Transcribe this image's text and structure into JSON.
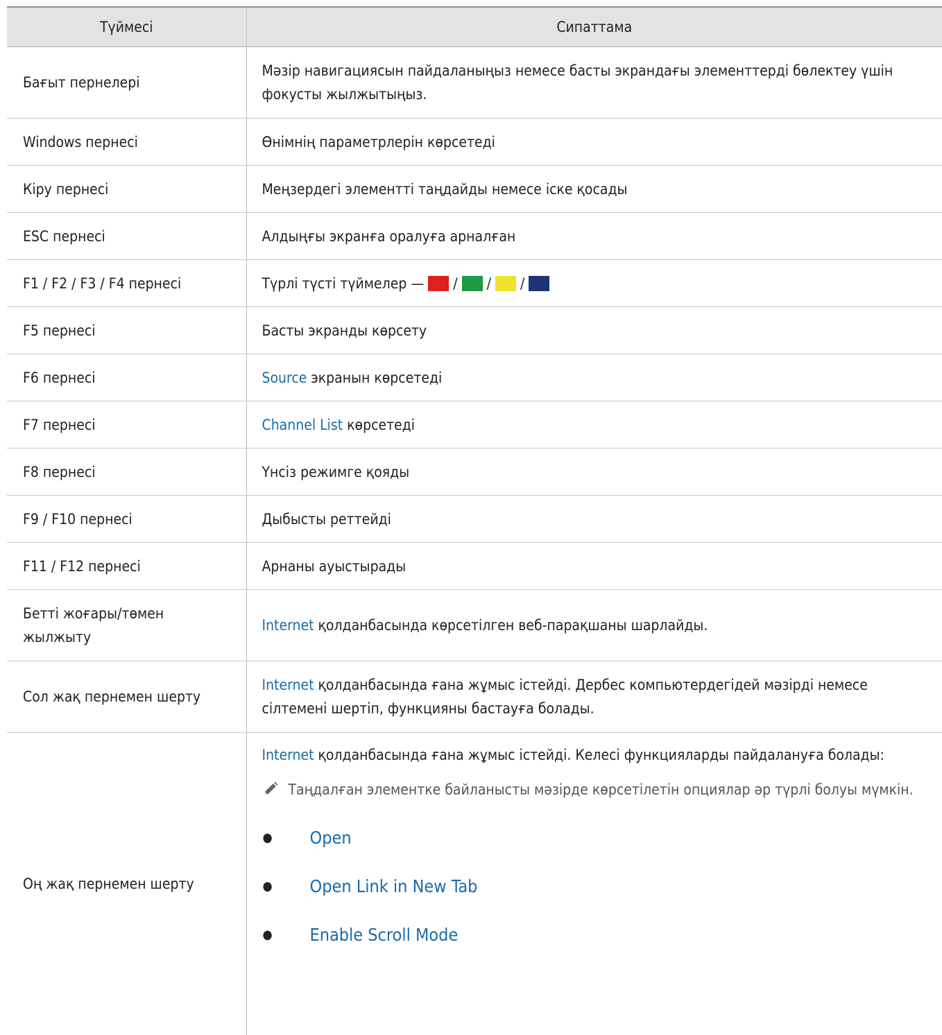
{
  "header": {
    "col_button": "Түймесі",
    "col_desc": "Сипаттама"
  },
  "rows": {
    "arrows": {
      "key": "Бағыт пернелері",
      "desc": "Мәзір навигациясын пайдаланыңыз немесе басты экрандағы элементтерді бөлектеу үшін фокусты жылжытыңыз."
    },
    "windows": {
      "key": "Windows пернесі",
      "desc": "Өнімнің параметрлерін көрсетеді"
    },
    "enter": {
      "key": "Кіру пернесі",
      "desc": "Меңзердегі элементті таңдайды немесе іске қосады"
    },
    "esc": {
      "key": "ESC пернесі",
      "desc": "Алдыңғы экранға оралуға арналған"
    },
    "f1f4": {
      "key": "F1 / F2 / F3 / F4 пернесі",
      "desc": "Түрлі түсті түймелер —",
      "sep": "/"
    },
    "f5": {
      "key": "F5 пернесі",
      "desc": "Басты экранды көрсету"
    },
    "f6": {
      "key": "F6 пернесі",
      "link": "Source",
      "desc": "экранын көрсетеді"
    },
    "f7": {
      "key": "F7 пернесі",
      "link": "Channel List",
      "desc": "көрсетеді"
    },
    "f8": {
      "key": "F8 пернесі",
      "desc": "Үнсіз режимге қояды"
    },
    "f9f10": {
      "key": "F9 / F10 пернесі",
      "desc": "Дыбысты реттейді"
    },
    "f11f12": {
      "key": "F11 / F12 пернесі",
      "desc": "Арнаны ауыстырады"
    },
    "pageupdown": {
      "key": "Бетті жоғары/төмен жылжыту",
      "link": "Internet",
      "desc": "қолданбасында көрсетілген веб-парақшаны шарлайды."
    },
    "leftclick": {
      "key": "Сол жақ пернемен шерту",
      "link": "Internet",
      "desc": "қолданбасында ғана жұмыс істейді. Дербес компьютердегідей мәзірді немесе сілтемені шертіп, функцияны бастауға болады."
    },
    "rightclick": {
      "key": "Оң жақ пернемен шерту",
      "link": "Internet",
      "desc": "қолданбасында ғана жұмыс істейді. Келесі функцияларды пайдалануға болады:",
      "note": "Таңдалған элементке байланысты мәзірде көрсетілетін опциялар әр түрлі болуы мүмкін.",
      "options": [
        "Open",
        "Open Link in New Tab",
        "Enable Scroll Mode"
      ]
    }
  },
  "colors": {
    "swatches": [
      "#e0201c",
      "#1e9a44",
      "#f0e22c",
      "#1f3177"
    ],
    "link": "#1a6aa9",
    "header_bg": "#e3e3e3"
  },
  "icons": {
    "note": "pencil-icon",
    "bullet": "bullet-dot"
  }
}
